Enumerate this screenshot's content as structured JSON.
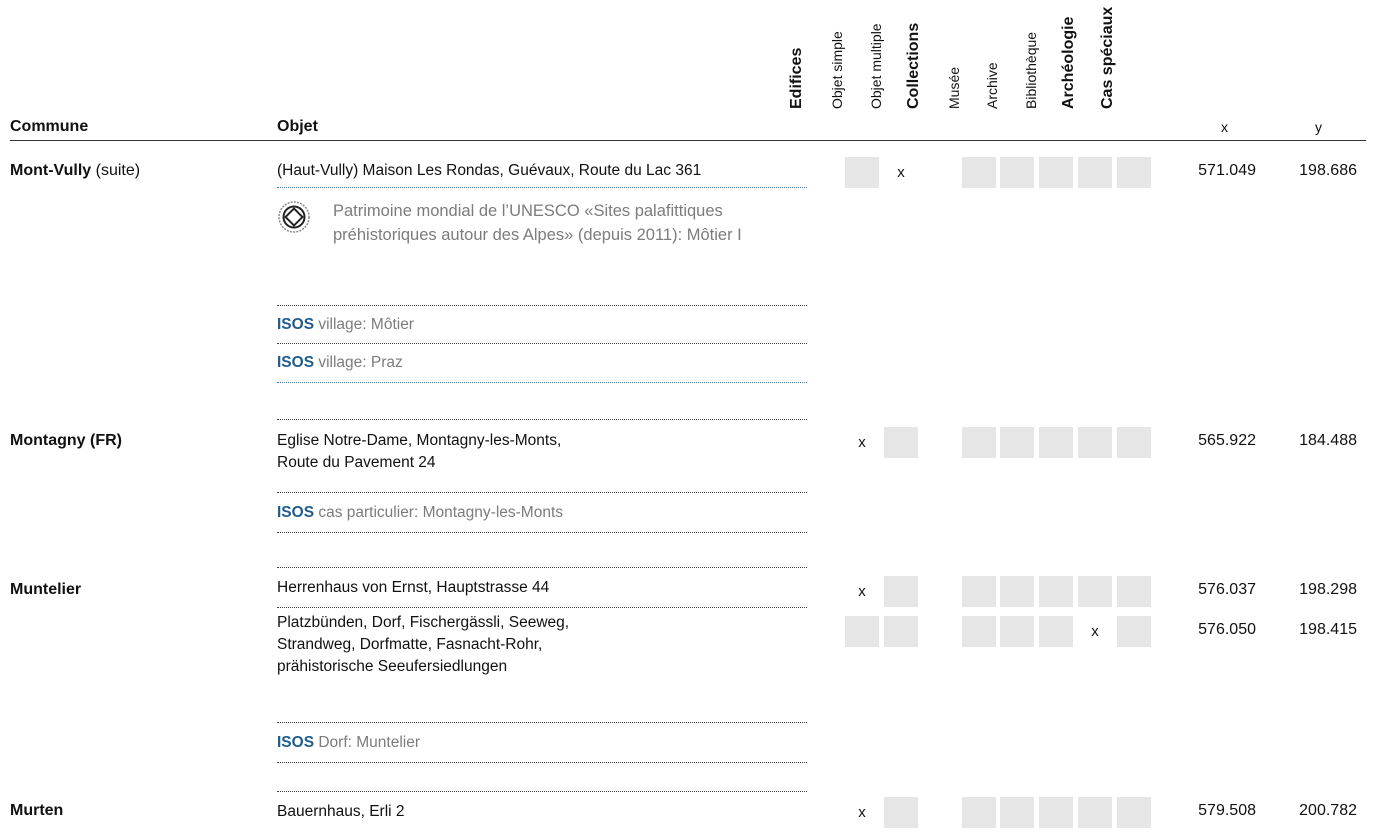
{
  "header": {
    "commune": "Commune",
    "objet": "Objet",
    "columns": [
      {
        "label": "Edifices",
        "bold": true
      },
      {
        "label": "Objet simple",
        "bold": false
      },
      {
        "label": "Objet multiple",
        "bold": false
      },
      {
        "label": "Collections",
        "bold": true
      },
      {
        "label": "Musée",
        "bold": false
      },
      {
        "label": "Archive",
        "bold": false
      },
      {
        "label": "Bibliothèque",
        "bold": false
      },
      {
        "label": "Archéologie",
        "bold": true
      },
      {
        "label": "Cas spéciaux",
        "bold": true
      }
    ],
    "x": "x",
    "y": "y"
  },
  "mark": "x",
  "rows": {
    "montvully": {
      "commune": "Mont-Vully",
      "commune_suffix": " (suite)",
      "objet": "(Haut-Vully) Maison Les Rondas, Guévaux, Route du Lac 361",
      "unesco_text": "Patrimoine mondial de l’UNESCO «Sites palafittiques préhistoriques autour des Alpes» (depuis 2011): Môtier I",
      "isos1_tag": "ISOS",
      "isos1_text": " village: Môtier",
      "isos2_tag": "ISOS",
      "isos2_text": " village: Praz",
      "x": "571.049",
      "y": "198.686"
    },
    "montagny": {
      "commune": "Montagny (FR)",
      "objet_line1": "Eglise Notre-Dame, Montagny-les-Monts,",
      "objet_line2": "Route du Pavement 24",
      "isos_tag": "ISOS",
      "isos_text": " cas particulier: Montagny-les-Monts",
      "x": "565.922",
      "y": "184.488"
    },
    "muntelier": {
      "commune": "Muntelier",
      "objet1": "Herrenhaus von Ernst, Hauptstrasse 44",
      "x1": "576.037",
      "y1": "198.298",
      "objet2_line1": "Platzbünden, Dorf, Fischergässli, Seeweg,",
      "objet2_line2": "Strandweg, Dorfmatte, Fasnacht-Rohr,",
      "objet2_line3": "prähistorische Seeufersiedlungen",
      "x2": "576.050",
      "y2": "198.415",
      "isos_tag": "ISOS",
      "isos_text": " Dorf: Muntelier"
    },
    "murten": {
      "commune": "Murten",
      "objet": "Bauernhaus, Erli 2",
      "x": "579.508",
      "y": "200.782"
    }
  }
}
